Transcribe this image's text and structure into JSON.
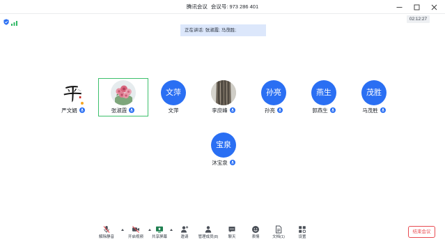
{
  "window": {
    "app_title": "腾讯会议",
    "meeting_id_label": "会议号:",
    "meeting_id": "973 286 401",
    "controls": [
      "minimize-icon",
      "maximize-icon",
      "close-icon"
    ]
  },
  "status": {
    "elapsed": "02:12:27",
    "security_icon": "shield-icon",
    "network_icon": "signal-bars-icon"
  },
  "speaking": {
    "text": "正在讲话: 张淑霞; 马茂胜;"
  },
  "participants": [
    {
      "name": "严文娟",
      "mic_icon": "mic-on-icon",
      "badge_icon": "host-badge-icon"
    },
    {
      "name": "张淑霞",
      "mic_icon": "mic-on-icon",
      "highlighted": true
    },
    {
      "name": "文萍",
      "avatar_text": "文萍"
    },
    {
      "name": "李庶峰",
      "mic_icon": "mic-on-icon"
    },
    {
      "name": "孙亮",
      "avatar_text": "孙亮",
      "mic_icon": "mic-on-icon"
    },
    {
      "name": "郭燕生",
      "avatar_text": "燕生",
      "mic_icon": "mic-on-icon"
    },
    {
      "name": "马茂胜",
      "avatar_text": "茂胜",
      "mic_icon": "mic-on-icon"
    },
    {
      "name": "沐宝泉",
      "avatar_text": "宝泉",
      "mic_icon": "mic-on-icon"
    }
  ],
  "toolbar": {
    "items": [
      {
        "label": "解除静音",
        "icon": "mic-muted-icon",
        "has_menu": true
      },
      {
        "label": "开启视频",
        "icon": "video-off-icon",
        "has_menu": true
      },
      {
        "label": "共享屏幕",
        "icon": "share-screen-icon",
        "has_menu": true
      },
      {
        "label": "邀请",
        "icon": "invite-icon"
      },
      {
        "label": "管理成员(8)",
        "icon": "members-icon"
      },
      {
        "label": "聊天",
        "icon": "chat-icon"
      },
      {
        "label": "表情",
        "icon": "emoji-icon"
      },
      {
        "label": "文档(1)",
        "icon": "document-icon"
      },
      {
        "label": "设置",
        "icon": "settings-grid-icon"
      }
    ],
    "end_meeting": "结束会议"
  },
  "colors": {
    "accent": "#2a6ff3",
    "active_border": "#3cbf6b",
    "danger": "#e8494f",
    "speaking_banner": "#dce7fb",
    "host_badge": "#f5a623"
  }
}
